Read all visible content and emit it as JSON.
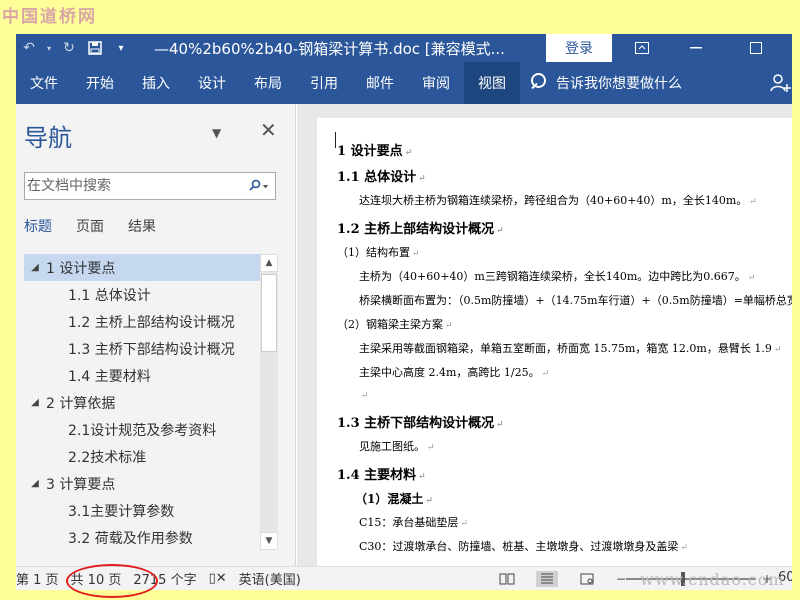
{
  "watermark_top": "中国道桥网",
  "watermark_bottom": "www.cndao.com",
  "titlebar": {
    "doc_title": "—40%2b60%2b40-钢箱梁计算书.doc [兼容模式...",
    "login": "登录"
  },
  "ribbon": {
    "tabs": [
      "文件",
      "开始",
      "插入",
      "设计",
      "布局",
      "引用",
      "邮件",
      "审阅",
      "视图"
    ],
    "active_tab": "视图",
    "tell_me": "告诉我你想要做什么"
  },
  "nav": {
    "title": "导航",
    "search_placeholder": "在文档中搜索",
    "tabs": [
      "标题",
      "页面",
      "结果"
    ],
    "active_tab": "标题",
    "tree": [
      {
        "label": "1 设计要点",
        "level": 1,
        "selected": true
      },
      {
        "label": "1.1 总体设计",
        "level": 2
      },
      {
        "label": "1.2 主桥上部结构设计概况",
        "level": 2
      },
      {
        "label": "1.3 主桥下部结构设计概况",
        "level": 2
      },
      {
        "label": "1.4 主要材料",
        "level": 2
      },
      {
        "label": "2 计算依据",
        "level": 1
      },
      {
        "label": "2.1设计规范及参考资料",
        "level": 2
      },
      {
        "label": "2.2技术标准",
        "level": 2
      },
      {
        "label": "3 计算要点",
        "level": 1
      },
      {
        "label": "3.1主要计算参数",
        "level": 2
      },
      {
        "label": "3.2 荷载及作用参数",
        "level": 2
      }
    ]
  },
  "document": {
    "lines": [
      {
        "text": "1 设计要点",
        "style": "h1",
        "indent": 0
      },
      {
        "text": "1.1 总体设计",
        "style": "h2",
        "indent": 0
      },
      {
        "text": "达连坝大桥主桥为钢箱连续梁桥，跨径组合为（40+60+40）m，全长140m。",
        "style": "bd",
        "indent": 22
      },
      {
        "text": "1.2 主桥上部结构设计概况",
        "style": "h2",
        "indent": 0
      },
      {
        "text": "（1）结构布置",
        "style": "bd",
        "indent": 0
      },
      {
        "text": "主桥为（40+60+40）m三跨钢箱连续梁桥，全长140m。边中跨比为0.667。",
        "style": "bd",
        "indent": 22
      },
      {
        "text": "桥梁横断面布置为：（0.5m防撞墙）+（14.75m车行道）+（0.5m防撞墙）=单幅桥总宽",
        "style": "bd",
        "indent": 22
      },
      {
        "text": "（2）钢箱梁主梁方案",
        "style": "bd",
        "indent": 0
      },
      {
        "text": "主梁采用等截面钢箱梁，单箱五室断面，桥面宽 15.75m，箱宽 12.0m，悬臂长 1.9",
        "style": "bd",
        "indent": 22
      },
      {
        "text": "主梁中心高度 2.4m，高跨比 1/25。",
        "style": "bd",
        "indent": 22
      },
      {
        "text": "",
        "style": "bd",
        "indent": 22
      },
      {
        "text": "1.3 主桥下部结构设计概况",
        "style": "h2",
        "indent": 0
      },
      {
        "text": "见施工图纸。",
        "style": "bd",
        "indent": 22
      },
      {
        "text": "1.4 主要材料",
        "style": "h2",
        "indent": 0
      },
      {
        "text": "（1）混凝土",
        "style": "h2s",
        "indent": 18
      },
      {
        "text": "C15：承台基础垫层",
        "style": "bd",
        "indent": 22
      },
      {
        "text": "C30：过渡墩承台、防撞墙、桩基、主墩墩身、过渡墩墩身及盖梁",
        "style": "bd",
        "indent": 22
      }
    ]
  },
  "status": {
    "page": "第 1 页",
    "total": "共 10 页",
    "words": "2715 个字",
    "language": "英语(美国)",
    "zoom": "60"
  }
}
